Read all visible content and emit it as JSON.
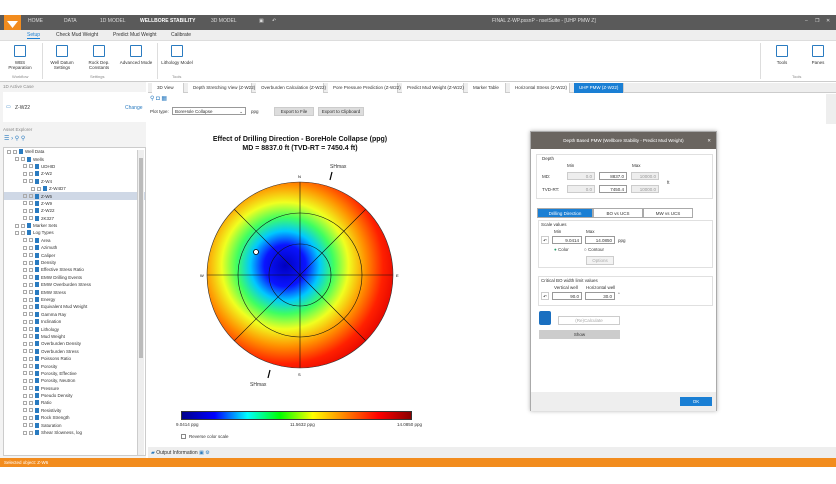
{
  "app": {
    "title": "FINAL Z-WP.pssnP - nsetSuite - [UHP PMW Z]",
    "menus": [
      "HOME",
      "DATA",
      "1D MODEL",
      "WELLBORE STABILITY",
      "3D MODEL"
    ],
    "active_menu": "WELLBORE STABILITY"
  },
  "ribbon": {
    "tabs": [
      "Setup",
      "Check Mud Weight",
      "Predict Mud Weight",
      "Calibrate"
    ],
    "active_tab": "Setup",
    "buttons": [
      {
        "label": "WBS Preparation",
        "group": "Workflow"
      },
      {
        "label": "Well Datum Settings",
        "group": "Settings"
      },
      {
        "label": "Rock Dep. Constants",
        "group": "Settings"
      },
      {
        "label": "Advanced Mode",
        "group": "Settings"
      },
      {
        "label": "Lithology Model",
        "group": "Tools"
      }
    ],
    "groups": [
      "Workflow",
      "Settings",
      "Tools"
    ],
    "right_buttons": [
      "Tools",
      "Panes"
    ],
    "right_group": "Tools"
  },
  "active_case": {
    "header": "1D Active Case",
    "well": "Z-W22",
    "change": "Change"
  },
  "explorer": {
    "header": "Asset Explorer",
    "items": [
      {
        "label": "Well Data",
        "level": 0
      },
      {
        "label": "Wells",
        "level": 1
      },
      {
        "label": "UDHID",
        "level": 2
      },
      {
        "label": "Z-W2",
        "level": 2
      },
      {
        "label": "Z-W4",
        "level": 2
      },
      {
        "label": "Z-W4D7",
        "level": 3
      },
      {
        "label": "Z-W6",
        "level": 2,
        "selected": true
      },
      {
        "label": "Z-W9",
        "level": 2
      },
      {
        "label": "Z-W22",
        "level": 2
      },
      {
        "label": "2K327",
        "level": 2
      },
      {
        "label": "Marker Sets",
        "level": 1
      },
      {
        "label": "Log Types",
        "level": 1
      },
      {
        "label": "Area",
        "level": 2
      },
      {
        "label": "Azimuth",
        "level": 2
      },
      {
        "label": "Caliper",
        "level": 2
      },
      {
        "label": "Density",
        "level": 2
      },
      {
        "label": "Effective Stress Ratio",
        "level": 2
      },
      {
        "label": "EMW Drilling Events",
        "level": 2
      },
      {
        "label": "EMW Overburden Stress",
        "level": 2
      },
      {
        "label": "EMW Stress",
        "level": 2
      },
      {
        "label": "Energy",
        "level": 2
      },
      {
        "label": "Equivalent Mud Weight",
        "level": 2
      },
      {
        "label": "Gamma Ray",
        "level": 2
      },
      {
        "label": "Inclination",
        "level": 2
      },
      {
        "label": "Lithology",
        "level": 2
      },
      {
        "label": "Mud Weight",
        "level": 2
      },
      {
        "label": "Overburden Density",
        "level": 2
      },
      {
        "label": "Overburden Stress",
        "level": 2
      },
      {
        "label": "Poissons Ratio",
        "level": 2
      },
      {
        "label": "Porosity",
        "level": 2
      },
      {
        "label": "Porosity, Effective",
        "level": 2
      },
      {
        "label": "Porosity, Neutron",
        "level": 2
      },
      {
        "label": "Pressure",
        "level": 2
      },
      {
        "label": "Pseudo Density",
        "level": 2
      },
      {
        "label": "Ratio",
        "level": 2
      },
      {
        "label": "Resistivity",
        "level": 2
      },
      {
        "label": "Rock Strength",
        "level": 2
      },
      {
        "label": "Saturation",
        "level": 2
      },
      {
        "label": "Shear Slowness, log",
        "level": 2
      }
    ]
  },
  "doc_tabs": [
    "3D View",
    "Depth Stretching View (Z-W22)",
    "Overburden Calculation (Z-W22)",
    "Pore Pressure Prediction (Z-W22)",
    "Predict Mud Weight (Z-W22)",
    "Marker Table",
    "Horizontal Stress (Z-W22)",
    "UHP PMW (Z-W22)"
  ],
  "active_doc_tab": "UHP PMW (Z-W22)",
  "plot": {
    "plot_type_label": "Plot type:",
    "plot_type": "BoreHole Collapse",
    "unit": "ppg",
    "export_file": "Export to File",
    "export_clipboard": "Export to Clipboard",
    "title1": "Effect of Drilling Direction - BoreHole Collapse (ppg)",
    "title2": "MD = 8837.0 ft (TVD-RT = 7450.4 ft)",
    "labels": {
      "shmax": "SHmax",
      "shmin": "SHmax",
      "n": "N",
      "s": "S",
      "e": "E",
      "w": "W"
    },
    "scale_min": "9.0414 ppg",
    "scale_mid": "11.5632 ppg",
    "scale_max": "14.0850 ppg",
    "reverse": "Reverse color scale",
    "colors": [
      "#00008b",
      "#0000ff",
      "#00ffff",
      "#00ff00",
      "#ffff00",
      "#ff8000",
      "#ff0000",
      "#8b0000"
    ]
  },
  "dialog": {
    "title": "Depth Based PMW (Wellbore Stability - Predict Mud Weight)",
    "depth": "Depth",
    "min": "Min",
    "max": "Max",
    "md_label": "MD:",
    "md_min": "0.0",
    "md_val": "8837.0",
    "md_max": "10000.0",
    "tvd_label": "TVD-RT:",
    "tvd_min": "0.0",
    "tvd_val": "7450.4",
    "tvd_max": "10000.0",
    "unit": "ft",
    "tabs": [
      "Drilling Direction",
      "BO vs UCS",
      "MW vs UCS"
    ],
    "scale_values": "Scale values",
    "s_min": "9.0414",
    "s_max": "14.0850",
    "s_unit": "ppg",
    "color": "Color",
    "contour": "Contour",
    "options": "Options",
    "critical": "Critical BO width limit values",
    "vert": "Vertical well",
    "horz": "Horizontal well",
    "vert_val": "90.0",
    "horz_val": "30.0",
    "deg": "°",
    "recalc": "(Re)Calculate",
    "show": "Show",
    "ok": "OK"
  },
  "output": "Output Information",
  "status": "Selected object: Z-W6"
}
